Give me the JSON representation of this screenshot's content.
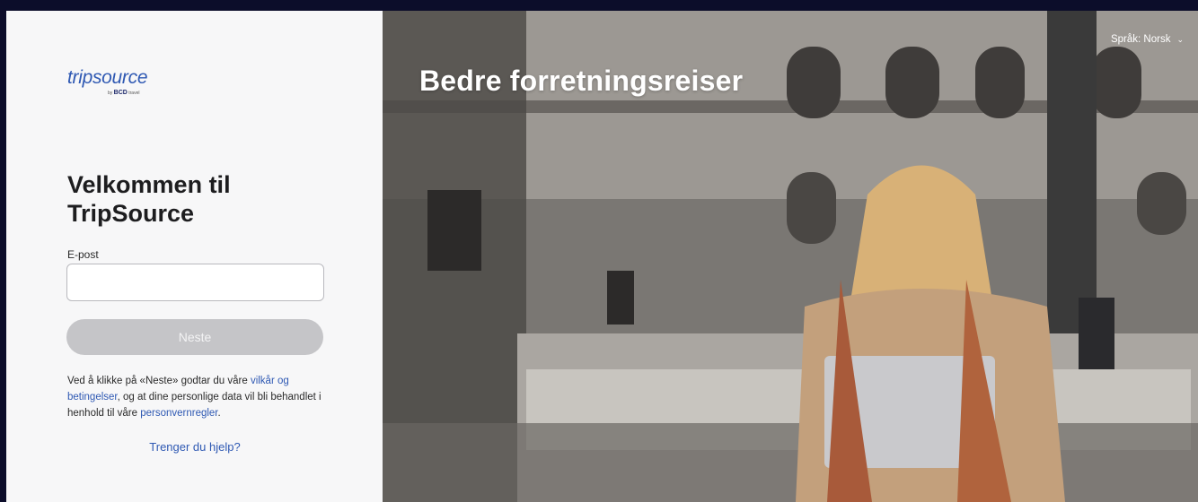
{
  "brand": {
    "logo_name": "tripsource",
    "logo_sub_by": "by",
    "logo_sub_bcd": "BCD",
    "logo_sub_travel": "travel"
  },
  "login": {
    "heading": "Velkommen til TripSource",
    "email_label": "E-post",
    "email_value": "",
    "next_label": "Neste",
    "terms_prefix": "Ved å klikke på «Neste» godtar du våre ",
    "terms_link": "vilkår og betingelser",
    "terms_middle": ", og at dine personlige data vil bli behandlet i henhold til våre ",
    "privacy_link": "personvernregler",
    "terms_suffix": ".",
    "help_link": "Trenger du hjelp?"
  },
  "hero": {
    "title": "Bedre forretningsreiser"
  },
  "language": {
    "label": "Språk: Norsk",
    "icon": "chevron-down-icon"
  },
  "colors": {
    "accent": "#2f59b3",
    "button_disabled": "#c5c5c8",
    "frame": "#0c0d2a"
  }
}
